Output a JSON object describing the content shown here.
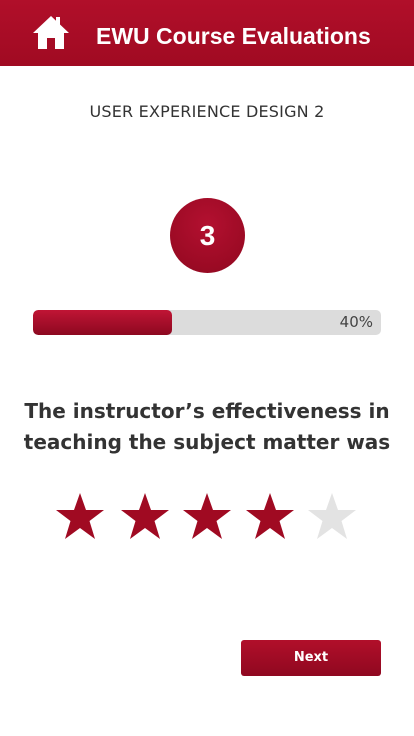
{
  "header": {
    "title": "EWU Course Evaluations",
    "home_icon": "home-icon"
  },
  "course": {
    "name": "USER EXPERIENCE DESIGN 2"
  },
  "question": {
    "number": "3",
    "text_line1": "The instructor’s effectiveness in",
    "text_line2": "teaching the subject matter was"
  },
  "progress": {
    "percent": 40,
    "label": "40%"
  },
  "rating": {
    "max": 5,
    "value": 4,
    "icon": "star-icon",
    "filled_color": "#a00a22",
    "empty_color": "#e3e3e3"
  },
  "actions": {
    "next_label": "Next"
  },
  "colors": {
    "accent": "#a00a22",
    "track": "#dcdcdc"
  }
}
